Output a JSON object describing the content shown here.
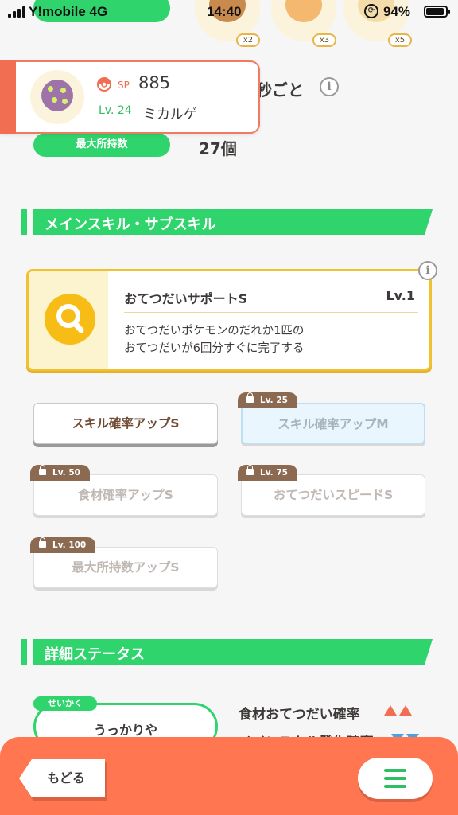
{
  "status_bar": {
    "carrier": "Y!mobile",
    "network": "4G",
    "time": "14:40",
    "battery_percent": "94%"
  },
  "top_items": [
    {
      "multiplier": "x2",
      "color": "#c07a3c"
    },
    {
      "multiplier": "x3",
      "color": "#f2b56a"
    },
    {
      "multiplier": "x5",
      "color": "#f4d9a4"
    }
  ],
  "pokemon": {
    "sp_label": "SP",
    "sp_value": "885",
    "level": "Lv. 24",
    "name": "ミカルゲ"
  },
  "help_interval_suffix": "秒ごと",
  "max_carry": {
    "label": "最大所持数",
    "value": "27個"
  },
  "skills_section": {
    "title": "メインスキル・サブスキル"
  },
  "main_skill": {
    "name": "おてつだいサポートS",
    "level": "Lv.1",
    "description_line1": "おてつだいポケモンのだれか1匹の",
    "description_line2": "おてつだいが6回分すぐに完了する",
    "icon": "magnifier-icon"
  },
  "sub_skills": [
    {
      "label": "スキル確率アップS",
      "lock_level": ""
    },
    {
      "label": "スキル確率アップM",
      "lock_level": "Lv. 25"
    },
    {
      "label": "食材確率アップS",
      "lock_level": "Lv. 50"
    },
    {
      "label": "おてつだいスピードS",
      "lock_level": "Lv. 75"
    },
    {
      "label": "最大所持数アップS",
      "lock_level": "Lv. 100"
    }
  ],
  "details_section": {
    "title": "詳細ステータス"
  },
  "nature": {
    "tag": "せいかく",
    "value": "うっかりや"
  },
  "stats": [
    {
      "label": "食材おてつだい確率",
      "trend": "up-up"
    },
    {
      "label": "メインスキル発生確率",
      "trend": "down-down"
    }
  ],
  "nav": {
    "back_label": "もどる",
    "menu_icon": "hamburger-icon"
  },
  "colors": {
    "accent_green": "#2fd46c",
    "bottom_bar": "#ff7650",
    "skill_border": "#f0c232",
    "lock_tag": "#8c6a51"
  }
}
